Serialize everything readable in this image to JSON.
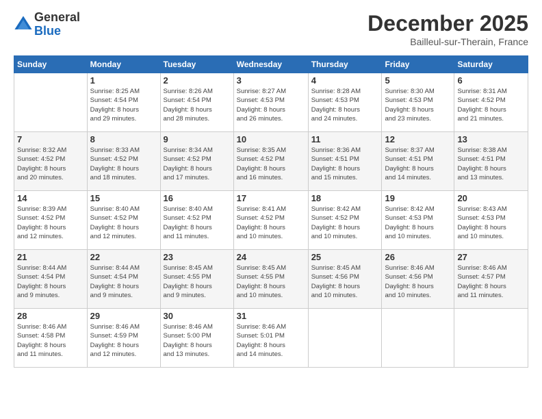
{
  "logo": {
    "general": "General",
    "blue": "Blue"
  },
  "header": {
    "month": "December 2025",
    "location": "Bailleul-sur-Therain, France"
  },
  "weekdays": [
    "Sunday",
    "Monday",
    "Tuesday",
    "Wednesday",
    "Thursday",
    "Friday",
    "Saturday"
  ],
  "weeks": [
    [
      {
        "day": "",
        "info": ""
      },
      {
        "day": "1",
        "info": "Sunrise: 8:25 AM\nSunset: 4:54 PM\nDaylight: 8 hours\nand 29 minutes."
      },
      {
        "day": "2",
        "info": "Sunrise: 8:26 AM\nSunset: 4:54 PM\nDaylight: 8 hours\nand 28 minutes."
      },
      {
        "day": "3",
        "info": "Sunrise: 8:27 AM\nSunset: 4:53 PM\nDaylight: 8 hours\nand 26 minutes."
      },
      {
        "day": "4",
        "info": "Sunrise: 8:28 AM\nSunset: 4:53 PM\nDaylight: 8 hours\nand 24 minutes."
      },
      {
        "day": "5",
        "info": "Sunrise: 8:30 AM\nSunset: 4:53 PM\nDaylight: 8 hours\nand 23 minutes."
      },
      {
        "day": "6",
        "info": "Sunrise: 8:31 AM\nSunset: 4:52 PM\nDaylight: 8 hours\nand 21 minutes."
      }
    ],
    [
      {
        "day": "7",
        "info": "Sunrise: 8:32 AM\nSunset: 4:52 PM\nDaylight: 8 hours\nand 20 minutes."
      },
      {
        "day": "8",
        "info": "Sunrise: 8:33 AM\nSunset: 4:52 PM\nDaylight: 8 hours\nand 18 minutes."
      },
      {
        "day": "9",
        "info": "Sunrise: 8:34 AM\nSunset: 4:52 PM\nDaylight: 8 hours\nand 17 minutes."
      },
      {
        "day": "10",
        "info": "Sunrise: 8:35 AM\nSunset: 4:52 PM\nDaylight: 8 hours\nand 16 minutes."
      },
      {
        "day": "11",
        "info": "Sunrise: 8:36 AM\nSunset: 4:51 PM\nDaylight: 8 hours\nand 15 minutes."
      },
      {
        "day": "12",
        "info": "Sunrise: 8:37 AM\nSunset: 4:51 PM\nDaylight: 8 hours\nand 14 minutes."
      },
      {
        "day": "13",
        "info": "Sunrise: 8:38 AM\nSunset: 4:51 PM\nDaylight: 8 hours\nand 13 minutes."
      }
    ],
    [
      {
        "day": "14",
        "info": "Sunrise: 8:39 AM\nSunset: 4:52 PM\nDaylight: 8 hours\nand 12 minutes."
      },
      {
        "day": "15",
        "info": "Sunrise: 8:40 AM\nSunset: 4:52 PM\nDaylight: 8 hours\nand 12 minutes."
      },
      {
        "day": "16",
        "info": "Sunrise: 8:40 AM\nSunset: 4:52 PM\nDaylight: 8 hours\nand 11 minutes."
      },
      {
        "day": "17",
        "info": "Sunrise: 8:41 AM\nSunset: 4:52 PM\nDaylight: 8 hours\nand 10 minutes."
      },
      {
        "day": "18",
        "info": "Sunrise: 8:42 AM\nSunset: 4:52 PM\nDaylight: 8 hours\nand 10 minutes."
      },
      {
        "day": "19",
        "info": "Sunrise: 8:42 AM\nSunset: 4:53 PM\nDaylight: 8 hours\nand 10 minutes."
      },
      {
        "day": "20",
        "info": "Sunrise: 8:43 AM\nSunset: 4:53 PM\nDaylight: 8 hours\nand 10 minutes."
      }
    ],
    [
      {
        "day": "21",
        "info": "Sunrise: 8:44 AM\nSunset: 4:54 PM\nDaylight: 8 hours\nand 9 minutes."
      },
      {
        "day": "22",
        "info": "Sunrise: 8:44 AM\nSunset: 4:54 PM\nDaylight: 8 hours\nand 9 minutes."
      },
      {
        "day": "23",
        "info": "Sunrise: 8:45 AM\nSunset: 4:55 PM\nDaylight: 8 hours\nand 9 minutes."
      },
      {
        "day": "24",
        "info": "Sunrise: 8:45 AM\nSunset: 4:55 PM\nDaylight: 8 hours\nand 10 minutes."
      },
      {
        "day": "25",
        "info": "Sunrise: 8:45 AM\nSunset: 4:56 PM\nDaylight: 8 hours\nand 10 minutes."
      },
      {
        "day": "26",
        "info": "Sunrise: 8:46 AM\nSunset: 4:56 PM\nDaylight: 8 hours\nand 10 minutes."
      },
      {
        "day": "27",
        "info": "Sunrise: 8:46 AM\nSunset: 4:57 PM\nDaylight: 8 hours\nand 11 minutes."
      }
    ],
    [
      {
        "day": "28",
        "info": "Sunrise: 8:46 AM\nSunset: 4:58 PM\nDaylight: 8 hours\nand 11 minutes."
      },
      {
        "day": "29",
        "info": "Sunrise: 8:46 AM\nSunset: 4:59 PM\nDaylight: 8 hours\nand 12 minutes."
      },
      {
        "day": "30",
        "info": "Sunrise: 8:46 AM\nSunset: 5:00 PM\nDaylight: 8 hours\nand 13 minutes."
      },
      {
        "day": "31",
        "info": "Sunrise: 8:46 AM\nSunset: 5:01 PM\nDaylight: 8 hours\nand 14 minutes."
      },
      {
        "day": "",
        "info": ""
      },
      {
        "day": "",
        "info": ""
      },
      {
        "day": "",
        "info": ""
      }
    ]
  ]
}
